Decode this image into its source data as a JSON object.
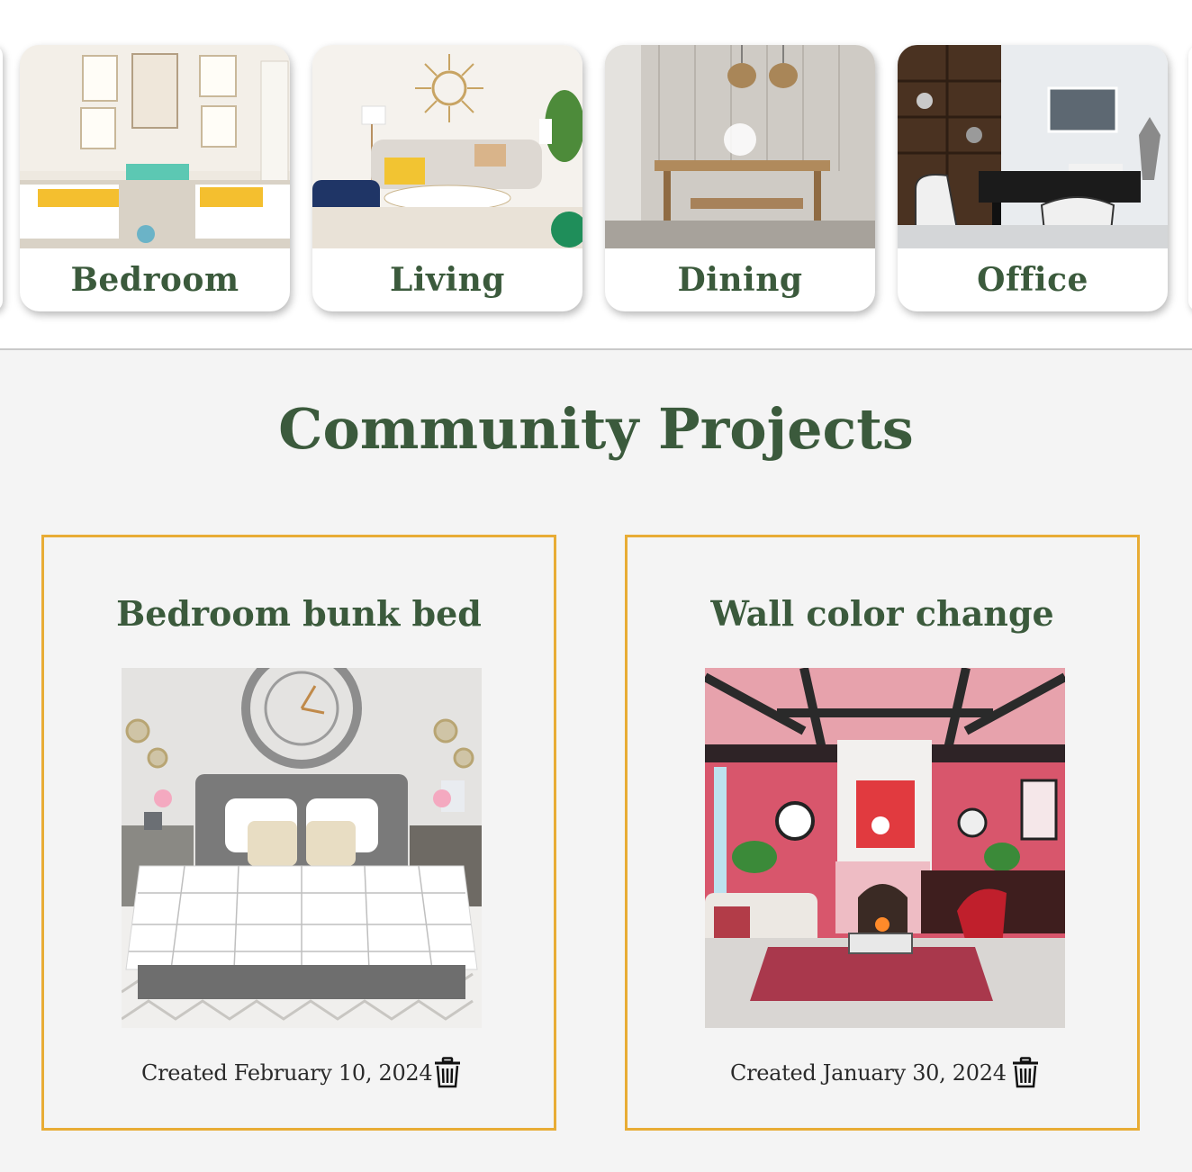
{
  "categories": [
    {
      "label": "Bedroom"
    },
    {
      "label": "Living"
    },
    {
      "label": "Dining"
    },
    {
      "label": "Office"
    }
  ],
  "community": {
    "title": "Community Projects",
    "projects": [
      {
        "title": "Bedroom bunk bed",
        "created": "Created February 10, 2024",
        "delete_icon": "trash-icon"
      },
      {
        "title": "Wall color change",
        "created": "Created January 30, 2024",
        "delete_icon": "trash-icon"
      }
    ]
  },
  "colors": {
    "accent_green": "#3b5a3c",
    "card_border": "#e8ac35",
    "section_bg": "#f4f4f4"
  }
}
